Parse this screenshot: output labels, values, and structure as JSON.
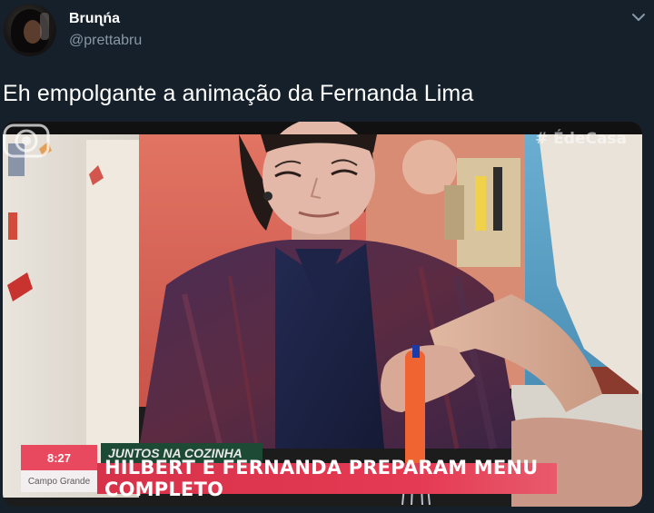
{
  "tweet": {
    "display_name": "Bruɳńa",
    "handle": "@prettabru",
    "text": "Eh empolgante a animação da Fernanda Lima",
    "menu_icon": "chevron-down-icon",
    "avatar_icon": "profile-photo"
  },
  "media": {
    "hashtag": "# ÉdeCasa",
    "lower_third": {
      "clock": "8:27",
      "city": "Campo Grande",
      "tag": "JUNTOS NA COZINHA",
      "headline": "HILBERT E FERNANDA PREPARAM MENU COMPLETO"
    },
    "logo_icon": "tv-globo-logo",
    "colors": {
      "headline_bar": "#e53a53",
      "tag_bar": "#1d4a35",
      "clock_box": "#e8495e"
    }
  },
  "theme": {
    "background": "#15202b",
    "secondary_text": "#8899a6"
  }
}
